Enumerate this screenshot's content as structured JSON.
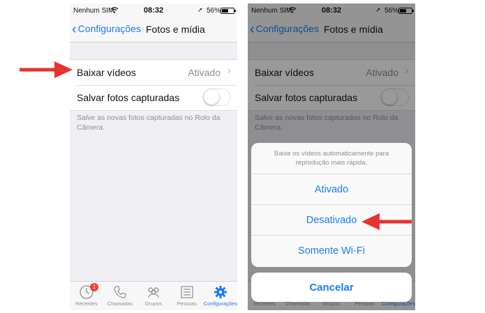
{
  "status_bar": {
    "carrier": "Nenhum SIM",
    "time": "08:32",
    "battery": "56%",
    "battery_level": 0.56
  },
  "nav": {
    "back_label": "Configurações",
    "title": "Fotos e mídia"
  },
  "settings": {
    "rows": [
      {
        "label": "Baixar vídeos",
        "value": "Ativado"
      },
      {
        "label": "Salvar fotos capturadas",
        "toggle_on": false
      }
    ],
    "footnote": "Salve as novas fotos capturadas no Rolo da Câmera."
  },
  "tab_bar": {
    "tabs": [
      {
        "label": "Recentes",
        "icon": "clock-icon",
        "badge": "1"
      },
      {
        "label": "Chamadas",
        "icon": "phone-icon"
      },
      {
        "label": "Grupos",
        "icon": "group-icon"
      },
      {
        "label": "Pessoas",
        "icon": "contacts-icon"
      },
      {
        "label": "Configurações",
        "icon": "gear-icon",
        "active": true
      }
    ]
  },
  "action_sheet": {
    "message": "Baixe os vídeos automaticamente para reprodução mais rápida.",
    "options": [
      "Ativado",
      "Desativado",
      "Somente Wi-Fi"
    ],
    "cancel": "Cancelar"
  },
  "colors": {
    "accent": "#1a7cf5",
    "annotation_arrow": "#e8322f",
    "badge": "#ff3b30"
  }
}
